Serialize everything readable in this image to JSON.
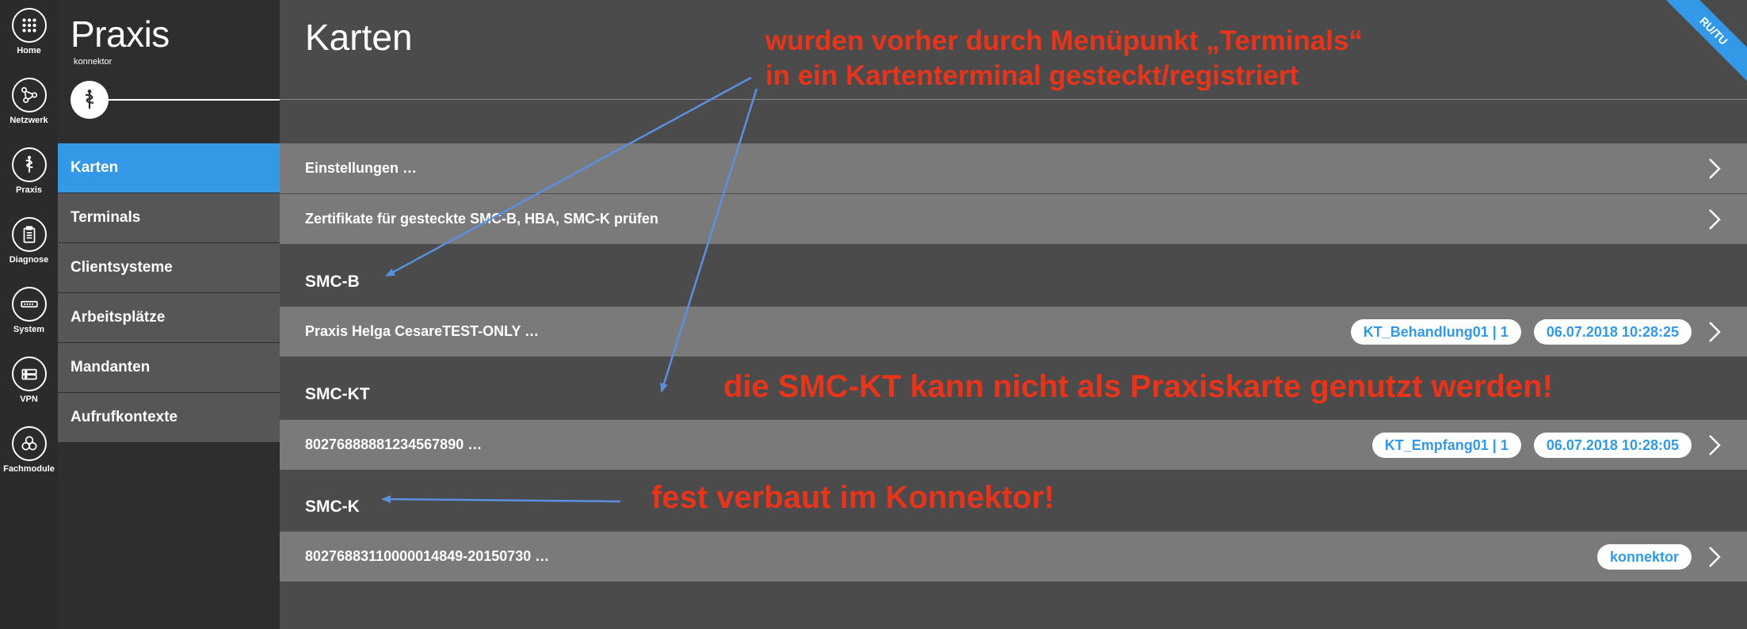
{
  "rail": {
    "items": [
      {
        "label": "Home",
        "icon": "grid-icon"
      },
      {
        "label": "Netzwerk",
        "icon": "network-icon"
      },
      {
        "label": "Praxis",
        "icon": "caduceus-icon"
      },
      {
        "label": "Diagnose",
        "icon": "clipboard-icon"
      },
      {
        "label": "System",
        "icon": "device-icon"
      },
      {
        "label": "VPN",
        "icon": "vpn-icon"
      },
      {
        "label": "Fachmodule",
        "icon": "modules-icon"
      }
    ]
  },
  "sidenav": {
    "title": "Praxis",
    "subtitle": "konnektor",
    "items": [
      {
        "label": "Karten",
        "active": true
      },
      {
        "label": "Terminals"
      },
      {
        "label": "Clientsysteme"
      },
      {
        "label": "Arbeitsplätze"
      },
      {
        "label": "Mandanten"
      },
      {
        "label": "Aufrufkontexte"
      }
    ]
  },
  "main": {
    "title": "Karten",
    "ribbon": "RU/TU",
    "actions": [
      {
        "label": "Einstellungen …"
      },
      {
        "label": "Zertifikate für gesteckte SMC-B, HBA, SMC-K prüfen"
      }
    ],
    "sections": [
      {
        "label": "SMC-B",
        "rows": [
          {
            "label": "Praxis Helga CesareTEST-ONLY …",
            "chips": [
              "KT_Behandlung01 | 1",
              "06.07.2018 10:28:25"
            ]
          }
        ]
      },
      {
        "label": "SMC-KT",
        "rows": [
          {
            "label": "80276888881234567890 …",
            "chips": [
              "KT_Empfang01 | 1",
              "06.07.2018 10:28:05"
            ]
          }
        ]
      },
      {
        "label": "SMC-K",
        "rows": [
          {
            "label": "80276883110000014849-20150730 …",
            "chips": [
              "konnektor"
            ]
          }
        ]
      }
    ]
  },
  "annotations": {
    "line1": "wurden vorher durch Menüpunkt „Terminals“",
    "line2": "in ein Kartenterminal gesteckt/registriert",
    "smckt": "die SMC-KT kann nicht als Praxiskarte genutzt werden!",
    "smck": "fest verbaut im Konnektor!"
  },
  "colors": {
    "accent": "#3399e6",
    "annotation": "#e8341a",
    "arrow": "#5b8fe0",
    "background": "#4b4b4b",
    "row": "#7a7a7a"
  }
}
